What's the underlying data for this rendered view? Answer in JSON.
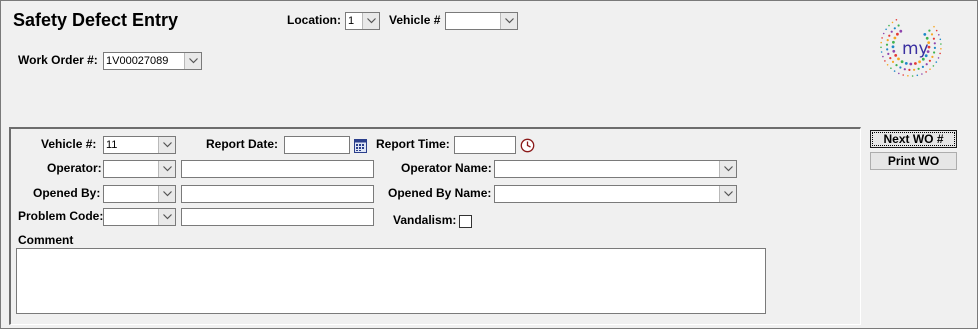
{
  "header": {
    "title": "Safety Defect Entry",
    "location_label": "Location:",
    "location_value": "1",
    "vehicle_label": "Vehicle #",
    "vehicle_value": "",
    "work_order_label": "Work Order #:",
    "work_order_value": "1V00027089"
  },
  "logo": {
    "text": "my",
    "colors": [
      "#1e88c7",
      "#3fb34f",
      "#f5a623",
      "#e53935",
      "#8e44ad"
    ]
  },
  "form": {
    "vehicle_label": "Vehicle #:",
    "vehicle_value": "11",
    "report_date_label": "Report Date:",
    "report_date_value": "",
    "report_time_label": "Report Time:",
    "report_time_value": "",
    "operator_label": "Operator:",
    "operator_name_label": "Operator Name:",
    "opened_by_label": "Opened By:",
    "opened_by_name_label": "Opened By Name:",
    "problem_code_label": "Problem Code:",
    "vandalism_label": "Vandalism:",
    "vandalism_checked": false,
    "comment_label": "Comment",
    "comment_value": ""
  },
  "buttons": {
    "next_wo": "Next WO #",
    "print_wo": "Print WO"
  }
}
